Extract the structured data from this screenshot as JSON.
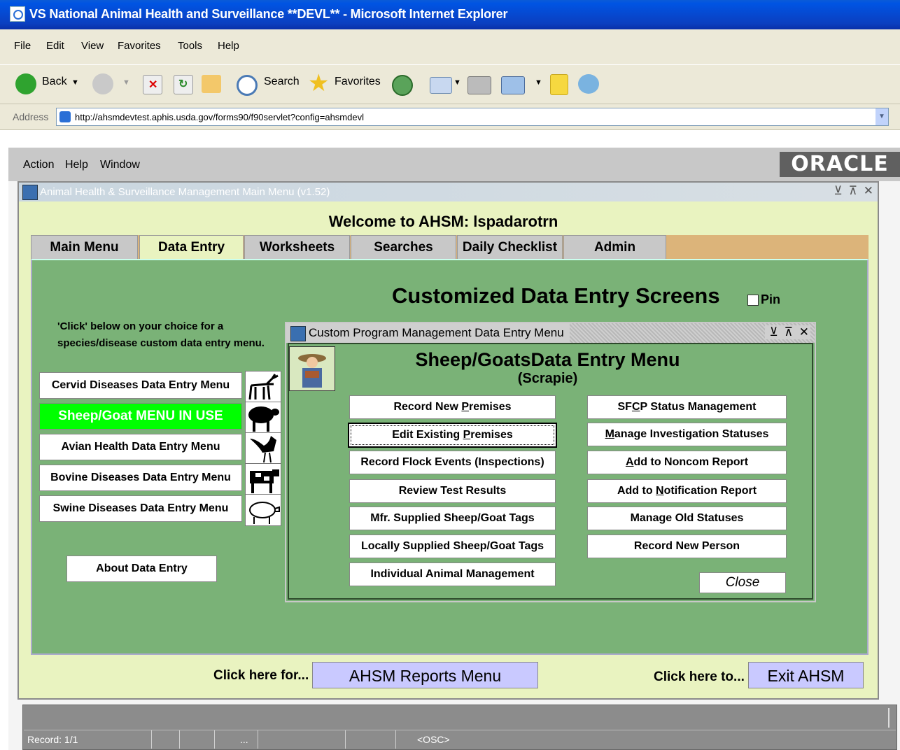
{
  "window": {
    "title": "VS National Animal Health and Surveillance **DEVL** - Microsoft Internet Explorer"
  },
  "ie_menu": [
    "File",
    "Edit",
    "View",
    "Favorites",
    "Tools",
    "Help"
  ],
  "toolbar": {
    "back": "Back",
    "search": "Search",
    "favorites": "Favorites"
  },
  "address": {
    "label": "Address",
    "value": "http://ahsmdevtest.aphis.usda.gov/forms90/f90servlet?config=ahsmdevl"
  },
  "forms_menu": [
    "Action",
    "Help",
    "Window"
  ],
  "oracle_logo": "ORACLE",
  "main_window": {
    "title": "Animal Health & Surveillance Management Main Menu (v1.52)",
    "welcome": "Welcome to AHSM: lspadarotrn",
    "tabs": [
      "Main Menu",
      "Data Entry",
      "Worksheets",
      "Searches",
      "Daily Checklist",
      "Admin"
    ],
    "active_tab": "Data Entry"
  },
  "panel": {
    "title": "Customized Data Entry Screens",
    "pin_label": "Pin",
    "instructions": "'Click' below on your choice for a species/disease custom data entry menu.",
    "species_buttons": [
      "Cervid Diseases Data Entry Menu",
      "Sheep/Goat MENU IN USE",
      "Avian Health Data Entry Menu",
      "Bovine Diseases Data Entry Menu",
      "Swine Diseases Data Entry Menu"
    ],
    "species_icons": [
      "deer-icon",
      "sheep-icon",
      "rooster-icon",
      "cow-icon",
      "pig-icon"
    ],
    "about_button": "About Data Entry"
  },
  "bottom": {
    "click_for": "Click here for...",
    "reports_button": "AHSM Reports Menu",
    "click_to": "Click here to...",
    "exit_button": "Exit AHSM"
  },
  "dialog": {
    "title": "Custom Program Management Data Entry Menu",
    "heading": "Sheep/GoatsData Entry Menu",
    "subheading": "(Scrapie)",
    "left_buttons": [
      {
        "pre": "Record New ",
        "u": "P",
        "post": "remises"
      },
      {
        "pre": "Edit Existing ",
        "u": "P",
        "post": "remises"
      },
      {
        "pre": "Record Flock Events (Inspections)",
        "u": "",
        "post": ""
      },
      {
        "pre": "Review Test Results",
        "u": "",
        "post": ""
      },
      {
        "pre": "Mfr. Supplied Sheep/Goat Tags",
        "u": "",
        "post": ""
      },
      {
        "pre": "Locally Supplied Sheep/Goat Tags",
        "u": "",
        "post": ""
      },
      {
        "pre": "Individual Animal Management",
        "u": "",
        "post": ""
      }
    ],
    "right_buttons": [
      {
        "pre": "SF",
        "u": "C",
        "post": "P Status Management"
      },
      {
        "pre": "",
        "u": "M",
        "post": "anage Investigation Statuses"
      },
      {
        "pre": "",
        "u": "A",
        "post": "dd to Noncom Report"
      },
      {
        "pre": "Add to ",
        "u": "N",
        "post": "otification Report"
      },
      {
        "pre": "Manage Old Statuses",
        "u": "",
        "post": ""
      },
      {
        "pre": "Record New Person",
        "u": "",
        "post": ""
      }
    ],
    "close_button": "Close"
  },
  "status": {
    "record": "Record: 1/1",
    "ellipsis": "...",
    "osc": "<OSC>"
  }
}
